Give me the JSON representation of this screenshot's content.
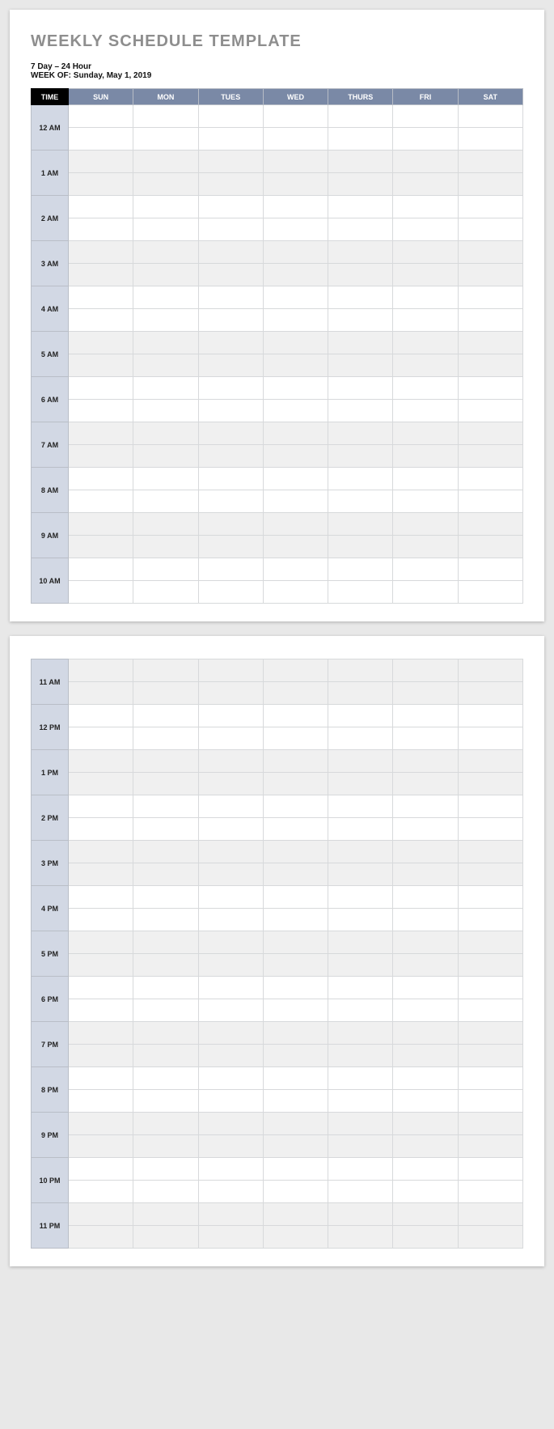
{
  "title": "WEEKLY SCHEDULE TEMPLATE",
  "subtitle1": "7 Day – 24 Hour",
  "subtitle2": "WEEK OF: Sunday, May 1, 2019",
  "header": {
    "time": "TIME",
    "days": [
      "SUN",
      "MON",
      "TUES",
      "WED",
      "THURS",
      "FRI",
      "SAT"
    ]
  },
  "page1_hours": [
    "12 AM",
    "1 AM",
    "2 AM",
    "3 AM",
    "4 AM",
    "5 AM",
    "6 AM",
    "7 AM",
    "8 AM",
    "9 AM",
    "10 AM"
  ],
  "page2_hours": [
    "11 AM",
    "12 PM",
    "1 PM",
    "2 PM",
    "3 PM",
    "4 PM",
    "5 PM",
    "6 PM",
    "7 PM",
    "8 PM",
    "9 PM",
    "10 PM",
    "11 PM"
  ]
}
